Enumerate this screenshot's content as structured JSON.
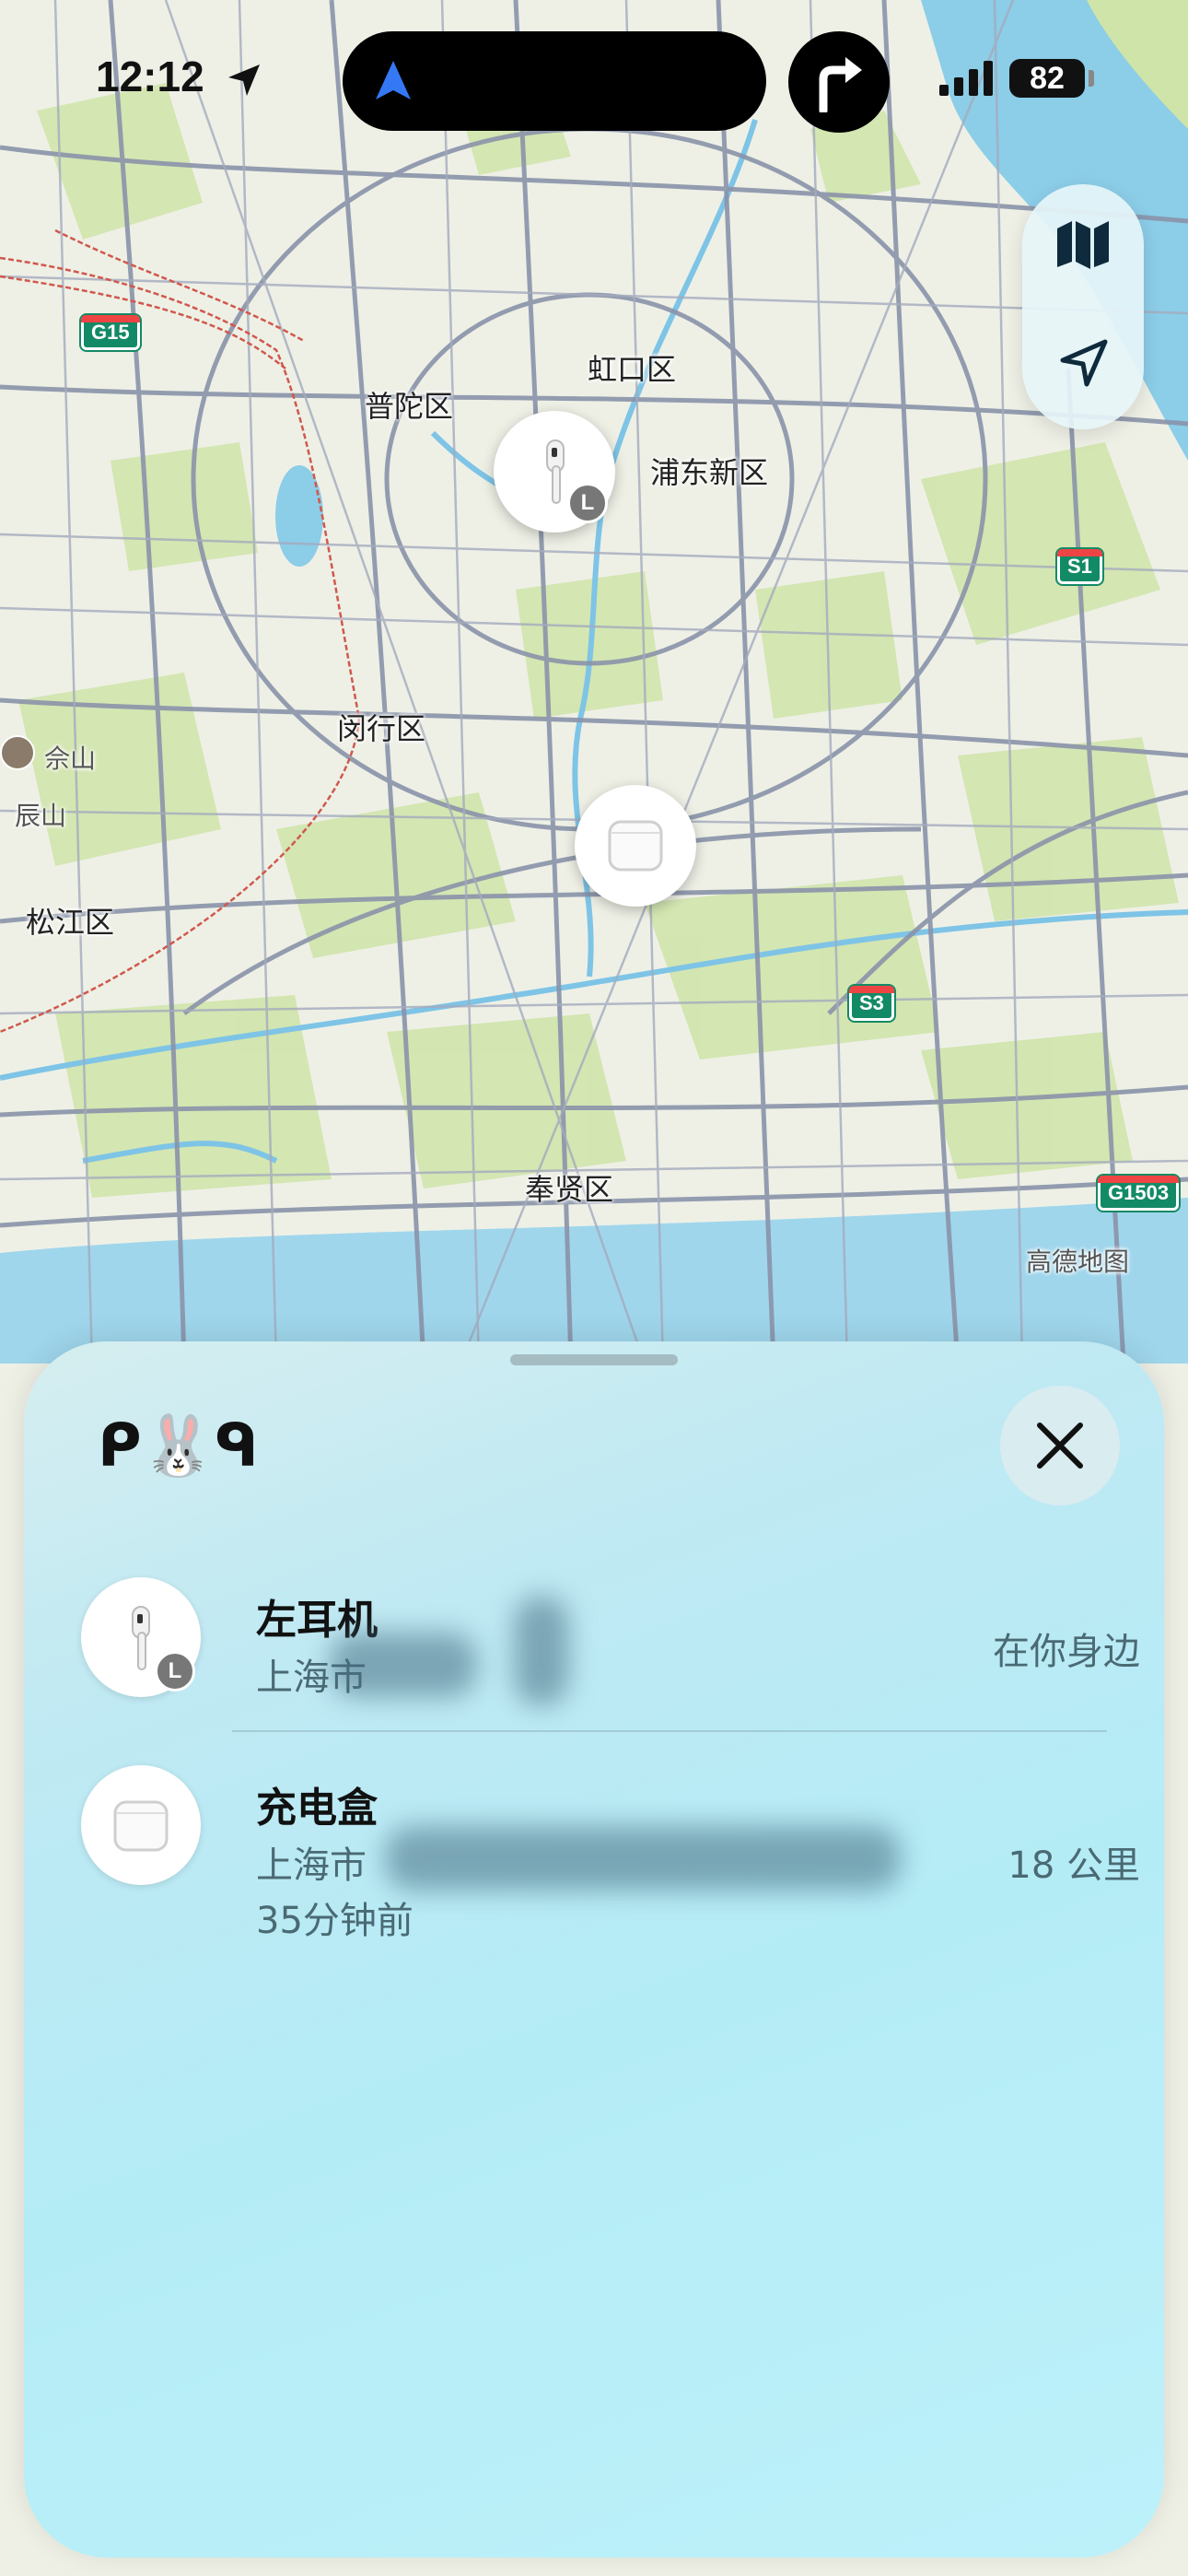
{
  "status_bar": {
    "time": "12:12",
    "battery": "82"
  },
  "map": {
    "labels": {
      "hongkou": "虹口区",
      "putuo": "普陀区",
      "pudong": "浦东新区",
      "minhang": "闵行区",
      "sheshan": "佘山",
      "chenshan": "辰山",
      "songjiang": "松江区",
      "fengxian": "奉贤区",
      "attribution": "高德地图"
    },
    "shields": {
      "g15": "G15",
      "s1": "S1",
      "s3": "S3",
      "g1503": "G1503",
      "g1_partial": "G1"
    },
    "colors": {
      "land": "#eef0e6",
      "water": "#8ccde8",
      "green": "#cfe4a8",
      "road": "#8a93aa"
    }
  },
  "sheet": {
    "title": "ᑭ🐰ᑫ",
    "items": [
      {
        "name": "左耳机",
        "location": "上海市",
        "distance": "在你身边",
        "badge": "L",
        "icon": "airpod-left-icon"
      },
      {
        "name": "充电盒",
        "location": "上海市",
        "time": "35分钟前",
        "distance": "18 公里",
        "icon": "charging-case-icon"
      }
    ]
  }
}
